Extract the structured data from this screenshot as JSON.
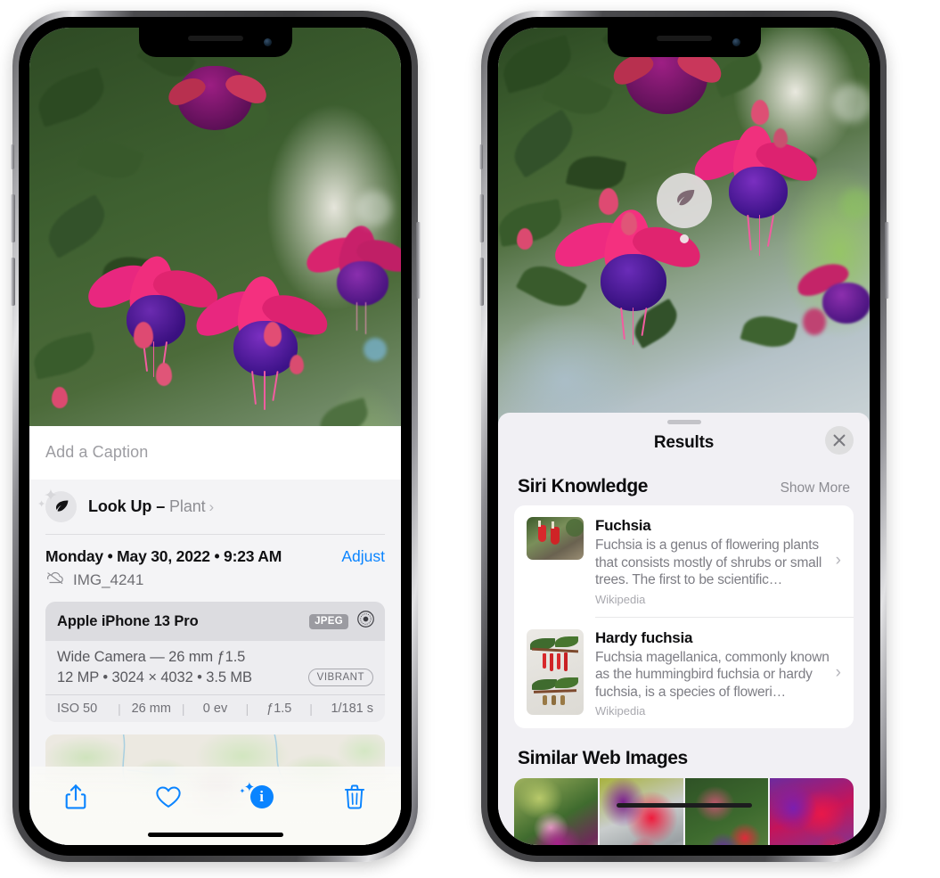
{
  "left_phone": {
    "name": "photos-detail-view",
    "caption": {
      "placeholder": "Add a Caption"
    },
    "lookup": {
      "label": "Look Up – ",
      "subject": "Plant",
      "chevron": "›",
      "icon": "leaf-icon",
      "sparkle": "✦",
      "sparkle_small": "✦"
    },
    "meta": {
      "date": "Monday • May 30, 2022 • 9:23 AM",
      "adjust_label": "Adjust",
      "filename": "IMG_4241",
      "cloud_icon": "cloud-slash-icon"
    },
    "camera_card": {
      "device": "Apple iPhone 13 Pro",
      "format_badge": "JPEG",
      "aperture_icon": "aperture-icon",
      "lens_line": "Wide Camera — 26 mm ƒ1.5",
      "specs_line": "12 MP • 3024 × 4032 • 3.5 MB",
      "style_badge": "VIBRANT",
      "exif": [
        "ISO 50",
        "26 mm",
        "0 ev",
        "ƒ1.5",
        "1/181 s"
      ],
      "exif_separator": "|"
    },
    "map": {
      "name": "location-map",
      "pin": "photo-pin-thumbnail"
    },
    "toolbar": {
      "share_icon": "share-icon",
      "favorite_icon": "heart-icon",
      "info_icon": "info-icon",
      "info_glyph": "i",
      "delete_icon": "trash-icon",
      "accent": "#0a84ff"
    }
  },
  "right_phone": {
    "name": "visual-lookup-results-view",
    "badge": {
      "icon": "leaf-icon",
      "name": "visual-lookup-badge"
    },
    "sheet": {
      "title": "Results",
      "close_icon": "close-icon",
      "grabber": "sheet-grabber"
    },
    "siri_knowledge": {
      "title": "Siri Knowledge",
      "show_more": "Show More",
      "items": [
        {
          "title": "Fuchsia",
          "desc": "Fuchsia is a genus of flowering plants that consists mostly of shrubs or small trees. The first to be scientific…",
          "source": "Wikipedia",
          "chevron": "›"
        },
        {
          "title": "Hardy fuchsia",
          "desc": "Fuchsia magellanica, commonly known as the hummingbird fuchsia or hardy fuchsia, is a species of floweri…",
          "source": "Wikipedia",
          "chevron": "›"
        }
      ]
    },
    "similar_web_images": {
      "title": "Similar Web Images",
      "count": 4
    }
  },
  "colors": {
    "accent_blue": "#0a84ff",
    "sheet_bg": "#f1f0f4",
    "info_bg": "#f4f4f6",
    "card_bg": "#ffffff",
    "muted_text": "#8e8e93"
  }
}
